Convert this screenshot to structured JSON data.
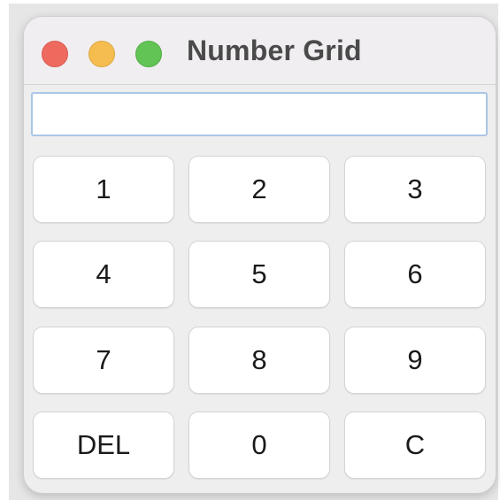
{
  "window": {
    "title": "Number Grid"
  },
  "display": {
    "value": "",
    "placeholder": ""
  },
  "keypad": {
    "keys": [
      {
        "label": "1"
      },
      {
        "label": "2"
      },
      {
        "label": "3"
      },
      {
        "label": "4"
      },
      {
        "label": "5"
      },
      {
        "label": "6"
      },
      {
        "label": "7"
      },
      {
        "label": "8"
      },
      {
        "label": "9"
      },
      {
        "label": "DEL"
      },
      {
        "label": "0"
      },
      {
        "label": "C"
      }
    ]
  },
  "colors": {
    "close": "#ee6a5f",
    "minimize": "#f5bd4f",
    "maximize": "#61c454",
    "display_border": "#a9c6e6"
  }
}
